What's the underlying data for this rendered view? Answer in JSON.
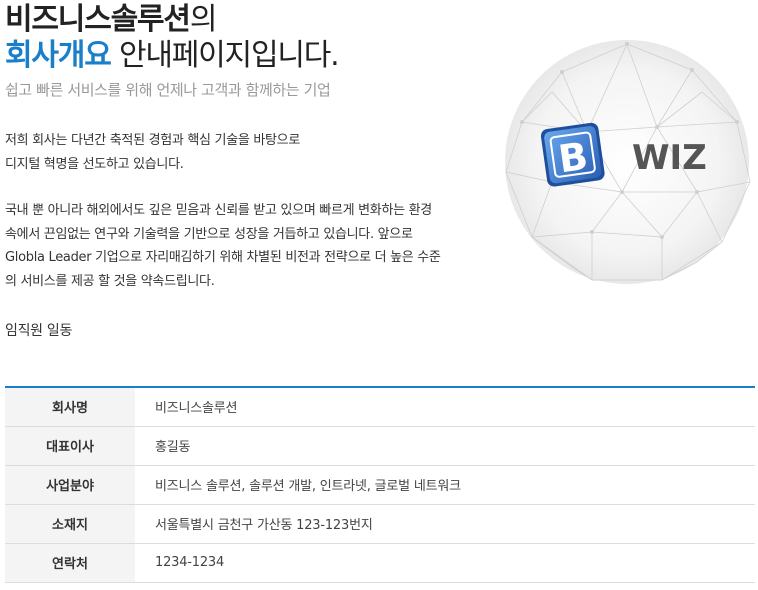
{
  "hero": {
    "line1_bold": "비즈니스솔루션",
    "line1_rest": "의",
    "line2_accent": "회사개요",
    "line2_rest": " 안내페이지입니다."
  },
  "subtitle": "쉽고 빠른 서비스를 위해 언제나 고객과 함께하는 기업",
  "intro": {
    "p1_line1": "저희 회사는 다년간 축적된 경험과 핵심 기술을 바탕으로",
    "p1_line2": "디지털 혁명을 선도하고 있습니다.",
    "p2_line1": "국내 뿐 아니라 해외에서도 깊은 믿음과 신뢰를 받고 있으며 빠르게 변화하는 환경",
    "p2_line2": "속에서 끈임없는 연구와 기술력을 기반으로 성장을 거듭하고 있습니다. 앞으로",
    "p2_line3": "Globla Leader 기업으로 자리매김하기 위해 차별된 비전과 전략으로 더 높은 수준",
    "p2_line4": "의 서비스를 제공 할 것을 약속드립니다."
  },
  "signature": "임직원 일동",
  "logo": {
    "letter": "B",
    "text": "WIZ"
  },
  "company_info": [
    {
      "label": "회사명",
      "value": "비즈니스솔루션"
    },
    {
      "label": "대표이사",
      "value": "홍길동"
    },
    {
      "label": "사업분야",
      "value": "비즈니스 솔루션, 솔루션 개발, 인트라넷, 글로벌 네트워크"
    },
    {
      "label": "소재지",
      "value": "서울특별시 금천구 가산동 123-123번지"
    },
    {
      "label": "연락처",
      "value": "1234-1234"
    }
  ],
  "colors": {
    "accent": "#1a7fc9",
    "logo_blue": "#3a78d0"
  }
}
